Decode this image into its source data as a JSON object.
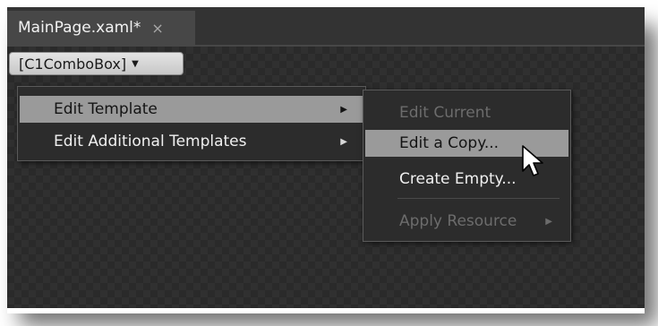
{
  "document_tab": {
    "title": "MainPage.xaml*",
    "close_glyph": "×"
  },
  "element_selector": {
    "label": "[C1ComboBox]",
    "caret_glyph": "▼"
  },
  "context_menu": {
    "items": [
      {
        "label": "Edit Template",
        "has_submenu": true,
        "highlighted": true,
        "enabled": true
      },
      {
        "label": "Edit Additional Templates",
        "has_submenu": true,
        "highlighted": false,
        "enabled": true
      }
    ]
  },
  "submenu": {
    "items": [
      {
        "label": "Edit Current",
        "enabled": false,
        "highlighted": false
      },
      {
        "label": "Edit a Copy...",
        "enabled": true,
        "highlighted": true
      },
      {
        "label": "Create Empty...",
        "enabled": true,
        "highlighted": false
      },
      {
        "label": "Apply Resource",
        "enabled": false,
        "has_submenu": true
      }
    ]
  },
  "arrow_glyph": "▶",
  "icons": {
    "cursor": "mouse-pointer-icon",
    "submenu_arrow": "chevron-right-icon",
    "dropdown": "chevron-down-icon",
    "close": "close-icon"
  },
  "colors": {
    "chrome": "#2d2d2d",
    "tab": "#474747",
    "highlight": "#9a9a9a",
    "disabled_text": "#6c6c6c"
  }
}
